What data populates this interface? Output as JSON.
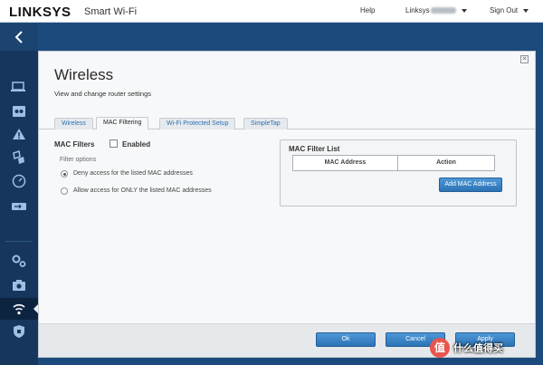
{
  "header": {
    "brand": "LINKSYS",
    "subbrand": "Smart Wi-Fi",
    "help": "Help",
    "user": "Linksys",
    "sign_out": "Sign Out"
  },
  "sidebar": {
    "items": [
      {
        "icon": "chevron-left-icon"
      },
      {
        "icon": "network-map-icon"
      },
      {
        "icon": "parental-controls-icon"
      },
      {
        "icon": "troubleshooting-icon"
      },
      {
        "icon": "media-prioritization-icon"
      },
      {
        "icon": "speed-test-icon"
      },
      {
        "icon": "external-storage-icon"
      },
      {
        "icon": "connectivity-settings-icon"
      },
      {
        "icon": "camera-icon"
      },
      {
        "icon": "wireless-icon"
      },
      {
        "icon": "security-icon"
      }
    ]
  },
  "dialog": {
    "title": "Wireless",
    "subtitle": "View and change router settings",
    "close": "✕",
    "tabs": [
      {
        "label": "Wireless",
        "active": false
      },
      {
        "label": "MAC Filtering",
        "active": true
      },
      {
        "label": "Wi-Fi Protected Setup",
        "active": false
      },
      {
        "label": "SimpleTap",
        "active": false
      }
    ],
    "mac_filters_label": "MAC Filters",
    "enabled_label": "Enabled",
    "enabled_checked": false,
    "filter_options_label": "Filter options",
    "options": [
      {
        "label": "Deny access for the listed MAC addresses",
        "selected": true
      },
      {
        "label": "Allow access for ONLY the listed MAC addresses",
        "selected": false
      }
    ],
    "mac_list": {
      "title": "MAC Filter List",
      "columns": [
        "MAC Address",
        "Action"
      ],
      "rows": [],
      "add_button": "Add MAC Address"
    },
    "footer": {
      "ok": "Ok",
      "cancel": "Cancel",
      "apply": "Apply"
    }
  },
  "watermark": {
    "badge": "值",
    "text": "什么值得买"
  },
  "colors": {
    "accent": "#2c73b6",
    "sidebar_bg": "#16365d",
    "page_bg": "#1d4a7c"
  }
}
